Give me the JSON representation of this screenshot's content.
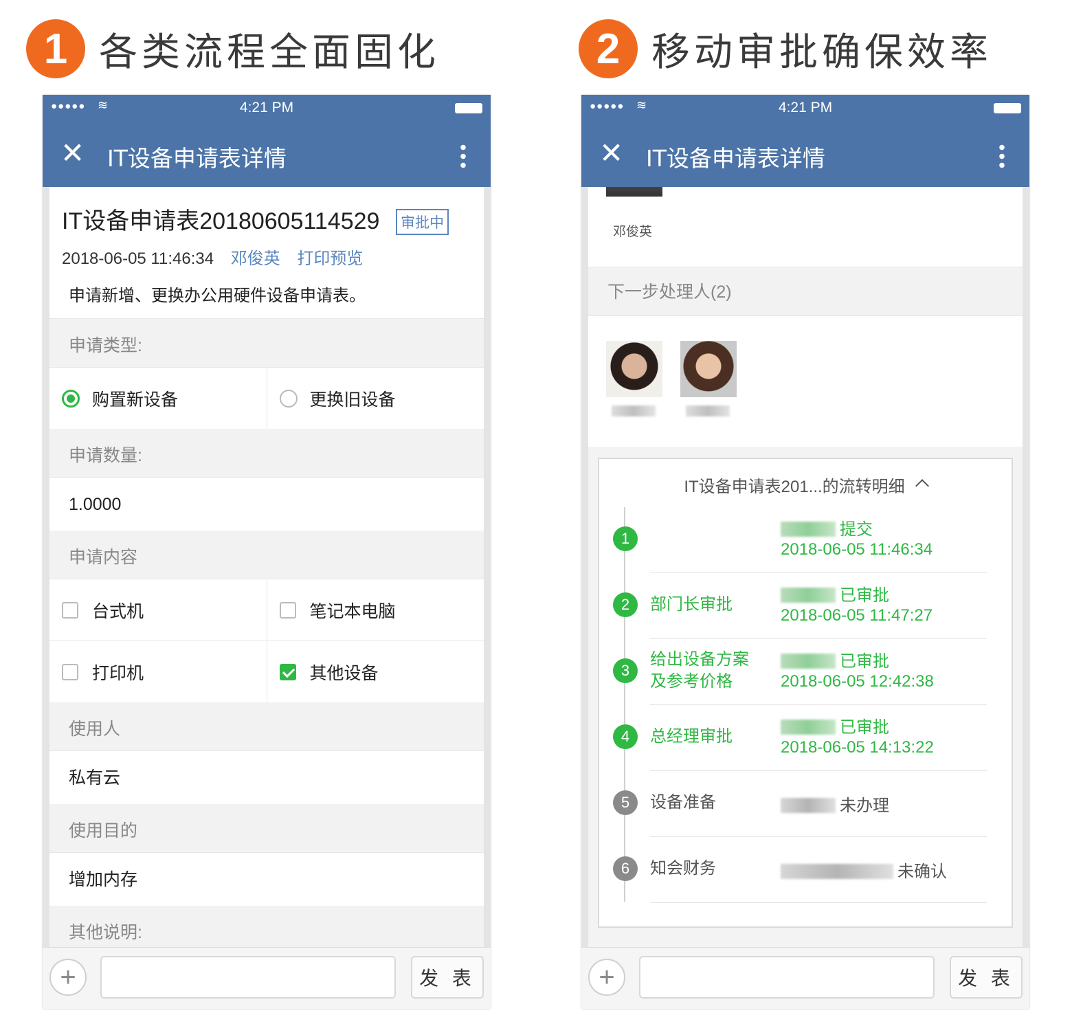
{
  "headings": [
    {
      "num": "1",
      "text": "各类流程全面固化"
    },
    {
      "num": "2",
      "text": "移动审批确保效率"
    }
  ],
  "statusbar": {
    "signal": "●●●●●",
    "time": "4:21 PM"
  },
  "navbar": {
    "close": "✕",
    "title": "IT设备申请表详情"
  },
  "phone1": {
    "doc_title": "IT设备申请表20180605114529",
    "status": "审批中",
    "date": "2018-06-05 11:46:34",
    "applicant": "邓俊英",
    "print_link": "打印预览",
    "description": "申请新增、更换办公用硬件设备申请表。",
    "type_label": "申请类型:",
    "type_options": [
      {
        "label": "购置新设备",
        "selected": true
      },
      {
        "label": "更换旧设备",
        "selected": false
      }
    ],
    "qty_label": "申请数量:",
    "qty_value": "1.0000",
    "content_label": "申请内容",
    "content_options": [
      {
        "label": "台式机",
        "checked": false
      },
      {
        "label": "笔记本电脑",
        "checked": false
      },
      {
        "label": "打印机",
        "checked": false
      },
      {
        "label": "其他设备",
        "checked": true
      }
    ],
    "user_label": "使用人",
    "user_value": "私有云",
    "purpose_label": "使用目的",
    "purpose_value": "增加内存",
    "other_label": "其他说明:"
  },
  "phone2": {
    "applicant_name": "邓俊英",
    "next_label": "下一步处理人(2)",
    "flow_title": "IT设备申请表201...的流转明细",
    "steps": [
      {
        "no": "1",
        "name": "",
        "status": "提交",
        "time": "2018-06-05 11:46:34"
      },
      {
        "no": "2",
        "name": "部门长审批",
        "status": "已审批",
        "time": "2018-06-05 11:47:27"
      },
      {
        "no": "3",
        "name": "给出设备方案\n及参考价格",
        "status": "已审批",
        "time": "2018-06-05 12:42:38"
      },
      {
        "no": "4",
        "name": "总经理审批",
        "status": "已审批",
        "time": "2018-06-05 14:13:22"
      },
      {
        "no": "5",
        "name": "设备准备",
        "status": "未办理",
        "time": ""
      },
      {
        "no": "6",
        "name": "知会财务",
        "status": "未确认",
        "time": ""
      }
    ]
  },
  "inputbar": {
    "plus": "+",
    "send": "发 表"
  },
  "colors": {
    "nav": "#4c74a8",
    "accent": "#ef6a1f",
    "green": "#2fb843",
    "link": "#5a86c0"
  }
}
